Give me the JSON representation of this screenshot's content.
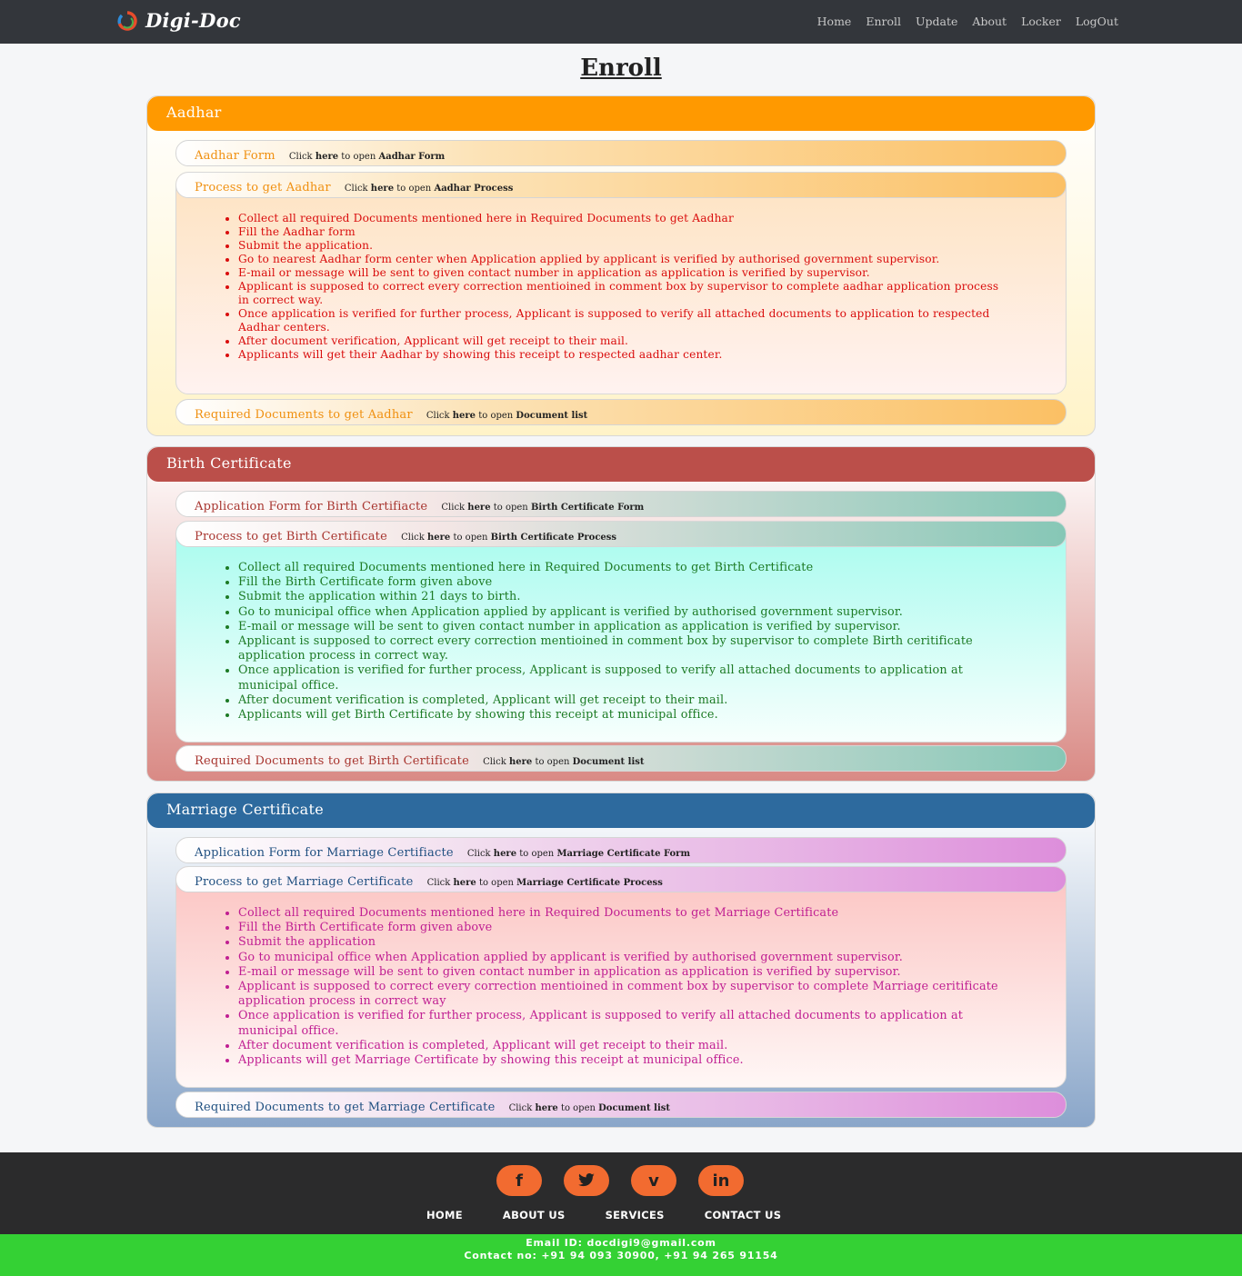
{
  "brand": {
    "name": "Digi-Doc"
  },
  "nav": [
    "Home",
    "Enroll",
    "Update",
    "About",
    "Locker",
    "LogOut"
  ],
  "page_title": "Enroll",
  "hint": {
    "click": "Click",
    "here": "here",
    "to_open": "to open"
  },
  "colors": {
    "aadhar": "#ff9900",
    "birth": "#bb4f4a",
    "marriage": "#2d6a9e",
    "footer_icons": "#f26b30",
    "contact_bar": "#34d134"
  },
  "aadhar": {
    "title": "Aadhar",
    "form": {
      "title": "Aadhar Form",
      "target": "Aadhar Form"
    },
    "process": {
      "title": "Process to get Aadhar",
      "target": "Aadhar Process"
    },
    "steps": [
      "Collect all required Documents mentioned here in Required Documents to get Aadhar",
      "Fill the Aadhar form",
      "Submit the application.",
      "Go to nearest Aadhar form center when Application applied by applicant is verified by authorised government supervisor.",
      "E-mail or message will be sent to given contact number in application as application is verified by supervisor.",
      "Applicant is supposed to correct every correction mentioined in comment box by supervisor to complete aadhar application process in correct way.",
      "Once application is verified for further process, Applicant is supposed to verify all attached documents to application to respected Aadhar centers.",
      "After document verification, Applicant will get receipt to their mail.",
      "Applicants will get their Aadhar by showing this receipt to respected aadhar center."
    ],
    "docs": {
      "title": "Required Documents to get Aadhar",
      "target": "Document list"
    }
  },
  "birth": {
    "title": "Birth Certificate",
    "form": {
      "title": "Application Form for Birth Certifiacte",
      "target": "Birth Certificate Form"
    },
    "process": {
      "title": "Process to get Birth Certificate",
      "target": "Birth Certificate Process"
    },
    "steps": [
      "Collect all required Documents mentioned here in Required Documents to get Birth Certificate",
      "Fill the Birth Certificate form given above",
      "Submit the application within 21 days to birth.",
      "Go to municipal office when Application applied by applicant is verified by authorised government supervisor.",
      "E-mail or message will be sent to given contact number in application as application is verified by supervisor.",
      "Applicant is supposed to correct every correction mentioined in comment box by supervisor to complete Birth ceritificate application process in correct way.",
      "Once application is verified for further process, Applicant is supposed to verify all attached documents to application at municipal office.",
      "After document verification is completed, Applicant will get receipt to their mail.",
      "Applicants will get Birth Certificate by showing this receipt at municipal office."
    ],
    "docs": {
      "title": "Required Documents to get Birth Certificate",
      "target": "Document list"
    }
  },
  "marriage": {
    "title": "Marriage Certificate",
    "form": {
      "title": "Application Form for Marriage Certifiacte",
      "target": "Marriage Certificate Form"
    },
    "process": {
      "title": "Process to get Marriage Certificate",
      "target": "Marriage Certificate Process"
    },
    "steps": [
      "Collect all required Documents mentioned here in Required Documents to get Marriage Certificate",
      "Fill the Birth Certificate form given above",
      "Submit the application",
      "Go to municipal office when Application applied by applicant is verified by authorised government supervisor.",
      "E-mail or message will be sent to given contact number in application as application is verified by supervisor.",
      "Applicant is supposed to correct every correction mentioined in comment box by supervisor to complete Marriage ceritificate application process in correct way",
      "Once application is verified for further process, Applicant is supposed to verify all attached documents to application at municipal office.",
      "After document verification is completed, Applicant will get receipt to their mail.",
      "Applicants will get Marriage Certificate by showing this receipt at municipal office."
    ],
    "docs": {
      "title": "Required Documents to get Marriage Certificate",
      "target": "Document list"
    }
  },
  "footer": {
    "social_icons": [
      "facebook-icon",
      "twitter-icon",
      "vimeo-icon",
      "linkedin-icon"
    ],
    "social_glyphs": [
      "f",
      "t",
      "v",
      "in"
    ],
    "links": [
      "HOME",
      "ABOUT US",
      "SERVICES",
      "CONTACT US"
    ],
    "email": "Email ID: docdigi9@gmail.com",
    "contact": "Contact no: +91 94 093 30900, +91 94 265 91154"
  }
}
